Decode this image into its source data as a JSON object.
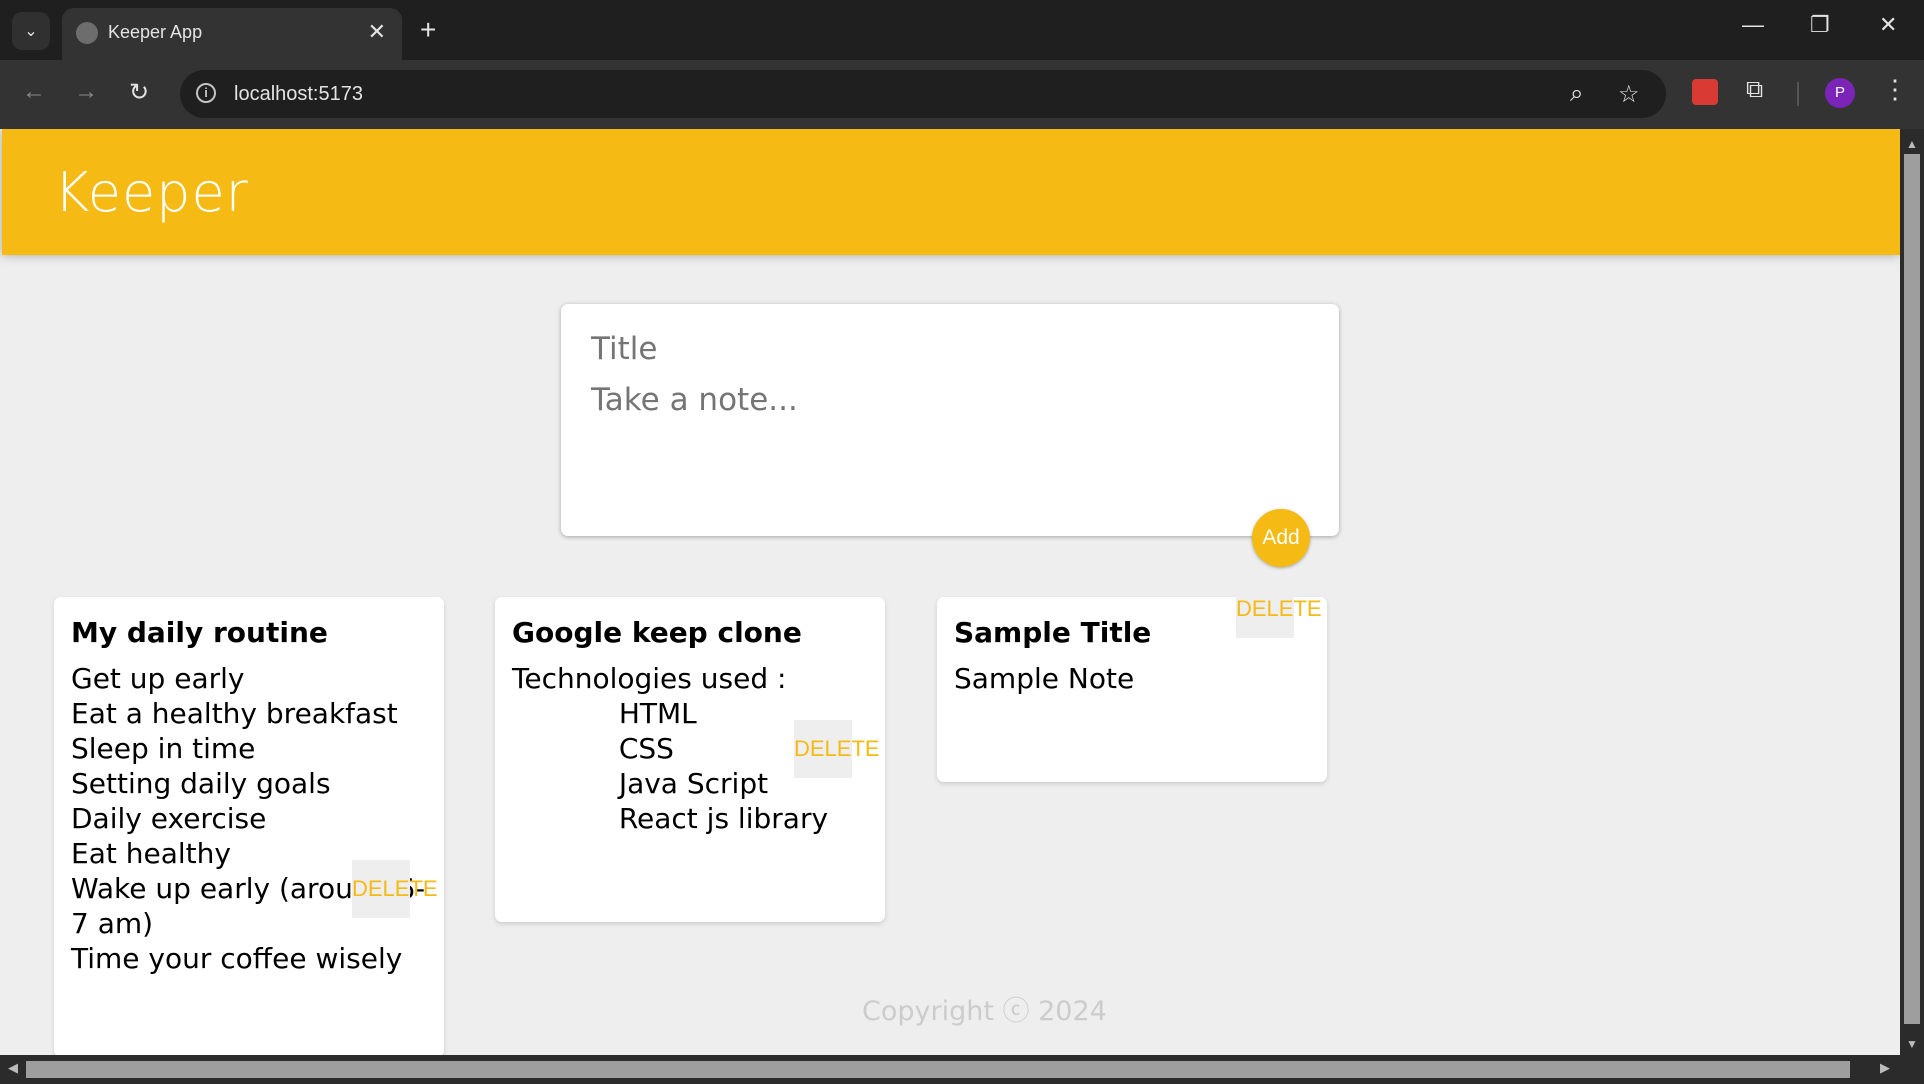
{
  "browser": {
    "tab_title": "Keeper App",
    "url": "localhost:5173",
    "profile_initial": "P",
    "new_tab_symbol": "+",
    "close_symbol": "✕",
    "back_symbol": "←",
    "forward_symbol": "→",
    "reload_symbol": "↻",
    "info_symbol": "i",
    "zoom_symbol": "⌕",
    "star_symbol": "☆",
    "minimize_symbol": "—",
    "restore_symbol": "❐",
    "window_close_symbol": "✕",
    "menu_symbol": "⋮",
    "tab_search_symbol": "⌄",
    "extensions_symbol": "⧉"
  },
  "app": {
    "title": "Keeper",
    "colors": {
      "brand": "#f5ba13",
      "background": "#eeeeee"
    }
  },
  "create_note": {
    "title_placeholder": "Title",
    "content_placeholder": "Take a note...",
    "add_label": "Add"
  },
  "notes": [
    {
      "title": "My daily routine",
      "content": "Get up early\nEat a healthy breakfast\nSleep in time\nSetting daily goals\nDaily exercise\nEat healthy\nWake up early (around 6-7 am)\nTime your coffee wisely",
      "delete_label": "DELETE"
    },
    {
      "title": "Google keep clone",
      "content": "Technologies used :\n            HTML\n            CSS\n            Java Script\n            React js library",
      "delete_label": "DELETE"
    },
    {
      "title": "Sample Title",
      "content": "Sample Note",
      "delete_label": "DELETE"
    }
  ],
  "footer": {
    "text": "Copyright ⓒ 2024"
  }
}
